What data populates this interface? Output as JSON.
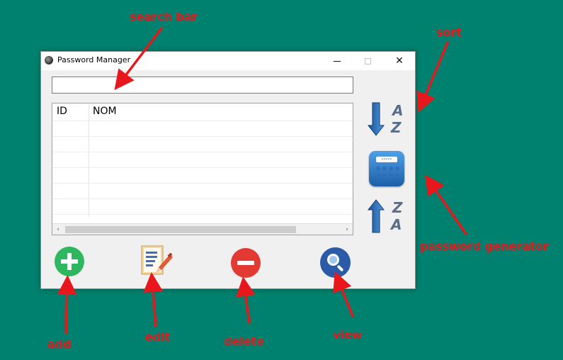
{
  "window": {
    "title": "Password Manager",
    "close_glyph": "✕"
  },
  "search": {
    "value": "",
    "placeholder": ""
  },
  "table": {
    "columns": [
      "ID",
      "NOM"
    ],
    "rows": []
  },
  "scrollbar": {
    "left_glyph": "‹",
    "right_glyph": "›"
  },
  "annotations": {
    "search_bar": "search bar",
    "sort": "sort",
    "password_generator": "password generator",
    "add": "add",
    "edit": "edit",
    "delete": "delete",
    "view": "view"
  },
  "icons": {
    "sort_asc": "sort-az-icon",
    "generator": "keypad-icon",
    "sort_desc": "sort-za-icon",
    "add": "plus-icon",
    "edit": "edit-document-icon",
    "delete": "minus-icon",
    "view": "magnifier-icon"
  },
  "sort_letters": {
    "asc_top": "A",
    "asc_bottom": "Z",
    "desc_top": "Z",
    "desc_bottom": "A"
  },
  "colors": {
    "desktop": "#00806e",
    "annotation": "#e8171c",
    "add": "#2fb760",
    "delete": "#e23a33",
    "view": "#2a5aa8"
  }
}
